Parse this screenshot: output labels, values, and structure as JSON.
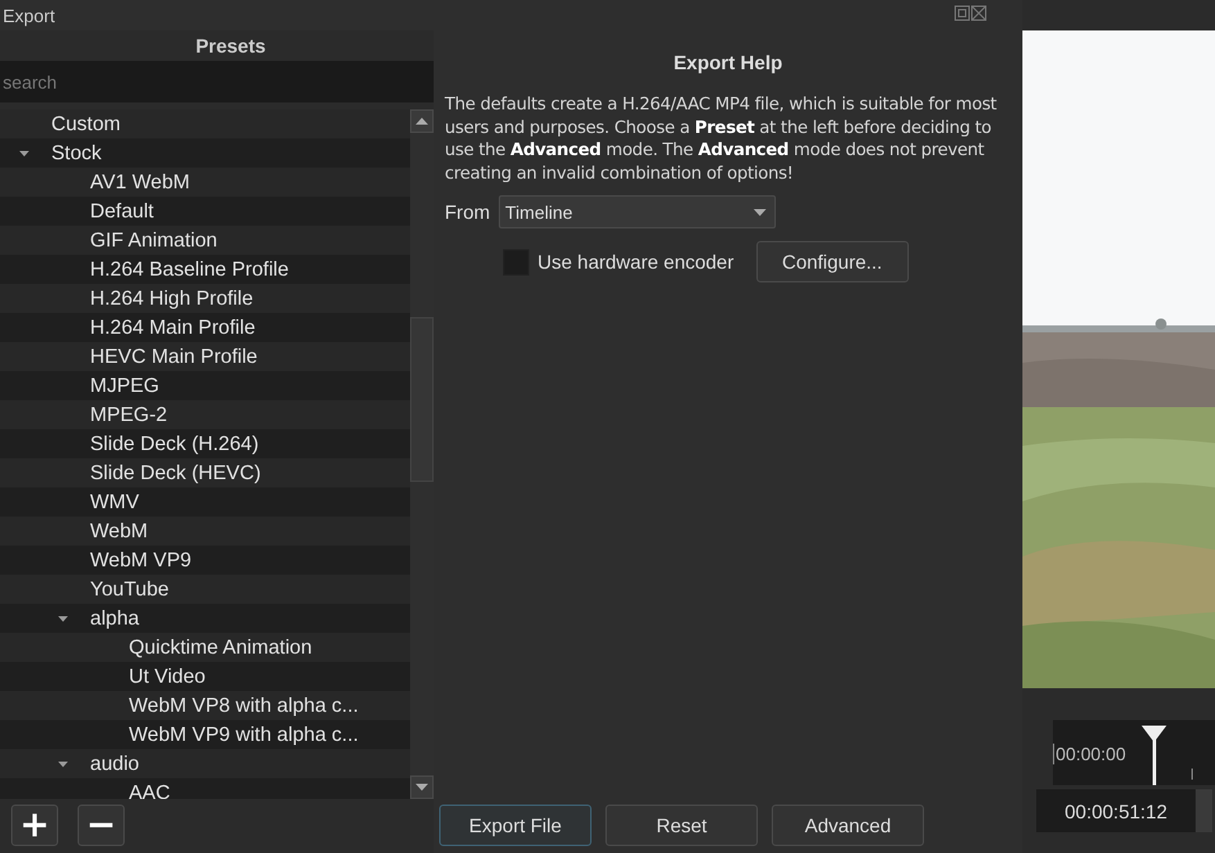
{
  "window": {
    "title": "Export"
  },
  "presets": {
    "title": "Presets",
    "search": {
      "placeholder": "search"
    },
    "tree": [
      {
        "label": "Custom",
        "selected": false
      },
      {
        "label": "Stock",
        "selected": false,
        "expanded": true,
        "children": [
          {
            "label": "AV1 WebM",
            "selected": false
          },
          {
            "label": "Default",
            "selected": false
          },
          {
            "label": "GIF Animation",
            "selected": false
          },
          {
            "label": "H.264 Baseline Profile",
            "selected": false
          },
          {
            "label": "H.264 High Profile",
            "selected": false
          },
          {
            "label": "H.264 Main Profile",
            "selected": false
          },
          {
            "label": "HEVC Main Profile",
            "selected": false
          },
          {
            "label": "MJPEG",
            "selected": false
          },
          {
            "label": "MPEG-2",
            "selected": false
          },
          {
            "label": "Slide Deck (H.264)",
            "selected": false
          },
          {
            "label": "Slide Deck (HEVC)",
            "selected": false
          },
          {
            "label": "WMV",
            "selected": false
          },
          {
            "label": "WebM",
            "selected": false
          },
          {
            "label": "WebM VP9",
            "selected": false
          },
          {
            "label": "YouTube",
            "selected": false
          },
          {
            "label": "alpha",
            "selected": false,
            "expanded": true,
            "children": [
              {
                "label": "Quicktime Animation",
                "selected": false
              },
              {
                "label": "Ut Video",
                "selected": false
              },
              {
                "label": "WebM VP8 with alpha c...",
                "selected": false
              },
              {
                "label": "WebM VP9 with alpha c...",
                "selected": false
              }
            ]
          },
          {
            "label": "audio",
            "selected": false,
            "expanded": true,
            "children": [
              {
                "label": "AAC",
                "selected": false
              }
            ]
          }
        ]
      }
    ],
    "add_button": "+",
    "remove_button": "−"
  },
  "help": {
    "title": "Export Help",
    "text": "The defaults create a H.264/AAC MP4 file, which is suitable for most users and purposes. Choose a **Preset** at the left before deciding to use the **Advanced** mode. The **Advanced** mode does not prevent creating an invalid combination of options!",
    "from_label": "From",
    "from_value": "Timeline",
    "hardware_encoder": {
      "label": "Use hardware encoder",
      "checked": false
    },
    "configure_button": "Configure..."
  },
  "buttons": [
    {
      "label": "Export File",
      "default": true
    },
    {
      "label": "Reset",
      "default": false
    },
    {
      "label": "Advanced",
      "default": false
    }
  ],
  "preview": {
    "kind": "picture",
    "ruler_time": "00:00:00",
    "position": "00:00:51:12"
  }
}
